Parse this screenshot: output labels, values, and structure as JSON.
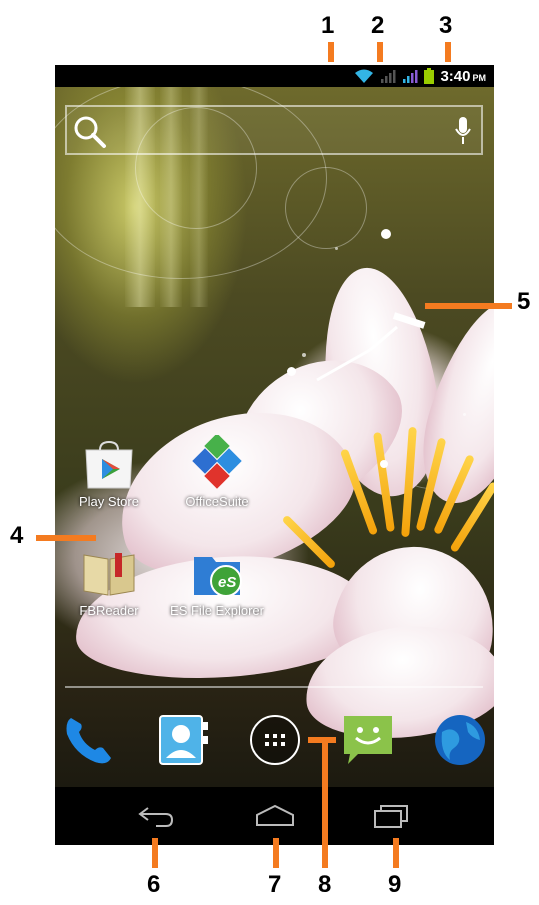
{
  "status_bar": {
    "time": "3:40",
    "ampm": "PM",
    "icons": [
      "wifi-icon",
      "signal-icon",
      "data-signal-icon",
      "battery-icon"
    ]
  },
  "search": {
    "icons": [
      "search-icon",
      "mic-icon"
    ]
  },
  "apps": [
    {
      "label": "Play Store",
      "icon": "play-store-icon"
    },
    {
      "label": "OfficeSuite",
      "icon": "officesuite-icon"
    },
    {
      "label": "FBReader",
      "icon": "fbreader-icon"
    },
    {
      "label": "ES File Explorer",
      "icon": "es-file-explorer-icon"
    }
  ],
  "dock": [
    "phone-icon",
    "contacts-icon",
    "all-apps-icon",
    "messaging-icon",
    "browser-icon"
  ],
  "nav": [
    "back-icon",
    "home-icon",
    "recent-apps-icon"
  ],
  "callouts": [
    "1",
    "2",
    "3",
    "4",
    "5",
    "6",
    "7",
    "8",
    "9"
  ],
  "colors": {
    "accent": "#f47b20",
    "wifi": "#33b5e5",
    "battery": "#99cc00"
  }
}
